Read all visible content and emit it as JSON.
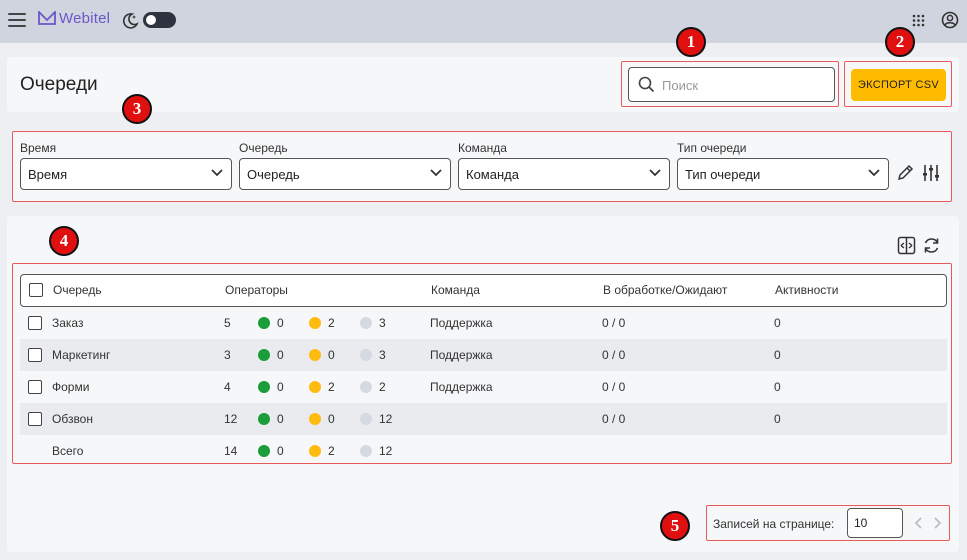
{
  "topbar": {
    "logo_text": "Webitel",
    "icons": [
      "menu-icon",
      "moon-icon",
      "theme-toggle",
      "apps-grid-icon",
      "account-icon"
    ]
  },
  "header": {
    "title": "Очереди",
    "search": {
      "placeholder": "Поиск",
      "value": ""
    },
    "export_label": "ЭКСПОРТ CSV"
  },
  "filters": [
    {
      "label": "Время",
      "value": "Время"
    },
    {
      "label": "Очередь",
      "value": "Очередь"
    },
    {
      "label": "Команда",
      "value": "Команда"
    },
    {
      "label": "Тип очереди",
      "value": "Тип очереди"
    }
  ],
  "table": {
    "columns": [
      "Очередь",
      "Операторы",
      "Команда",
      "В обработке/Ожидают",
      "Активности"
    ],
    "rows": [
      {
        "queue": "Заказ",
        "operators": "5",
        "green": "0",
        "yellow": "2",
        "grey": "3",
        "team": "Поддержка",
        "processing": "0 / 0",
        "activity": "0",
        "checkbox": true
      },
      {
        "queue": "Маркетинг",
        "operators": "3",
        "green": "0",
        "yellow": "0",
        "grey": "3",
        "team": "Поддержка",
        "processing": "0 / 0",
        "activity": "0",
        "checkbox": true
      },
      {
        "queue": "Форми",
        "operators": "4",
        "green": "0",
        "yellow": "2",
        "grey": "2",
        "team": "Поддержка",
        "processing": "0 / 0",
        "activity": "0",
        "checkbox": true
      },
      {
        "queue": "Обзвон",
        "operators": "12",
        "green": "0",
        "yellow": "0",
        "grey": "12",
        "team": "",
        "processing": "0 / 0",
        "activity": "0",
        "checkbox": true
      },
      {
        "queue": "Всего",
        "operators": "14",
        "green": "0",
        "yellow": "2",
        "grey": "12",
        "team": "",
        "processing": "",
        "activity": "",
        "checkbox": false
      }
    ]
  },
  "pagination": {
    "label": "Записей на странице:",
    "per_page": "10"
  },
  "annotations": [
    "1",
    "2",
    "3",
    "4",
    "5"
  ],
  "colors": {
    "accent": "#ffbb00",
    "annotation": "#e01010",
    "status_free": "#1a9e3a",
    "status_busy": "#ffbb11",
    "status_offline": "#d5d9e0"
  }
}
